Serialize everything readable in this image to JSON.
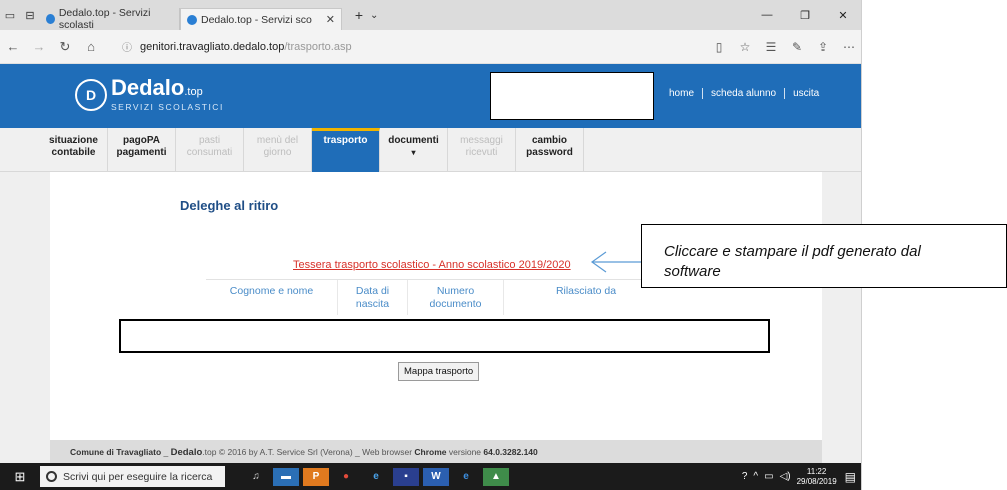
{
  "browser": {
    "tabs": [
      {
        "title": "Dedalo.top - Servizi scolasti",
        "active": false
      },
      {
        "title": "Dedalo.top - Servizi sco",
        "active": true
      }
    ],
    "url_domain": "genitori.travagliato.dedalo.top",
    "url_path": "/trasporto.asp"
  },
  "site": {
    "logo_text": "Dedalo",
    "logo_tld": ".top",
    "logo_subtitle": "SERVIZI SCOLASTICI",
    "top_nav": [
      "home",
      "scheda alunno",
      "uscita"
    ],
    "main_nav": [
      {
        "line1": "situazione",
        "line2": "contabile",
        "state": "enabled"
      },
      {
        "line1": "pagoPA",
        "line2": "pagamenti",
        "state": "enabled"
      },
      {
        "line1": "pasti",
        "line2": "consumati",
        "state": "disabled"
      },
      {
        "line1": "menù del",
        "line2": "giorno",
        "state": "disabled"
      },
      {
        "line1": "trasporto",
        "line2": "",
        "state": "active"
      },
      {
        "line1": "documenti",
        "line2": "▾",
        "state": "enabled"
      },
      {
        "line1": "messaggi",
        "line2": "ricevuti",
        "state": "disabled"
      },
      {
        "line1": "cambio",
        "line2": "password",
        "state": "enabled"
      }
    ],
    "accent": "#1f6db8"
  },
  "content": {
    "heading": "Deleghe al ritiro",
    "pdf_link": "Tessera trasporto scolastico - Anno scolastico 2019/2020",
    "table_headers": [
      {
        "line1": "Cognome e nome",
        "line2": ""
      },
      {
        "line1": "Data di",
        "line2": "nascita"
      },
      {
        "line1": "Numero",
        "line2": "documento"
      },
      {
        "line1": "Rilasciato da",
        "line2": ""
      }
    ],
    "map_button": "Mappa trasporto"
  },
  "footer": {
    "comune": "Comune di Travagliato",
    "sep1": " _ ",
    "brand": "Dedalo",
    "brand_tld": ".top",
    "copyright": " © 2016 by A.T. Service Srl (Verona) _ Web browser ",
    "browser_name": "Chrome",
    "version_text": " versione ",
    "version": "64.0.3282.140"
  },
  "taskbar": {
    "search_placeholder": "Scrivi qui per eseguire la ricerca",
    "time": "11:22",
    "date": "29/08/2019"
  },
  "annotation": {
    "text_line1": "Cliccare e stampare il pdf generato dal",
    "text_line2": "software"
  }
}
